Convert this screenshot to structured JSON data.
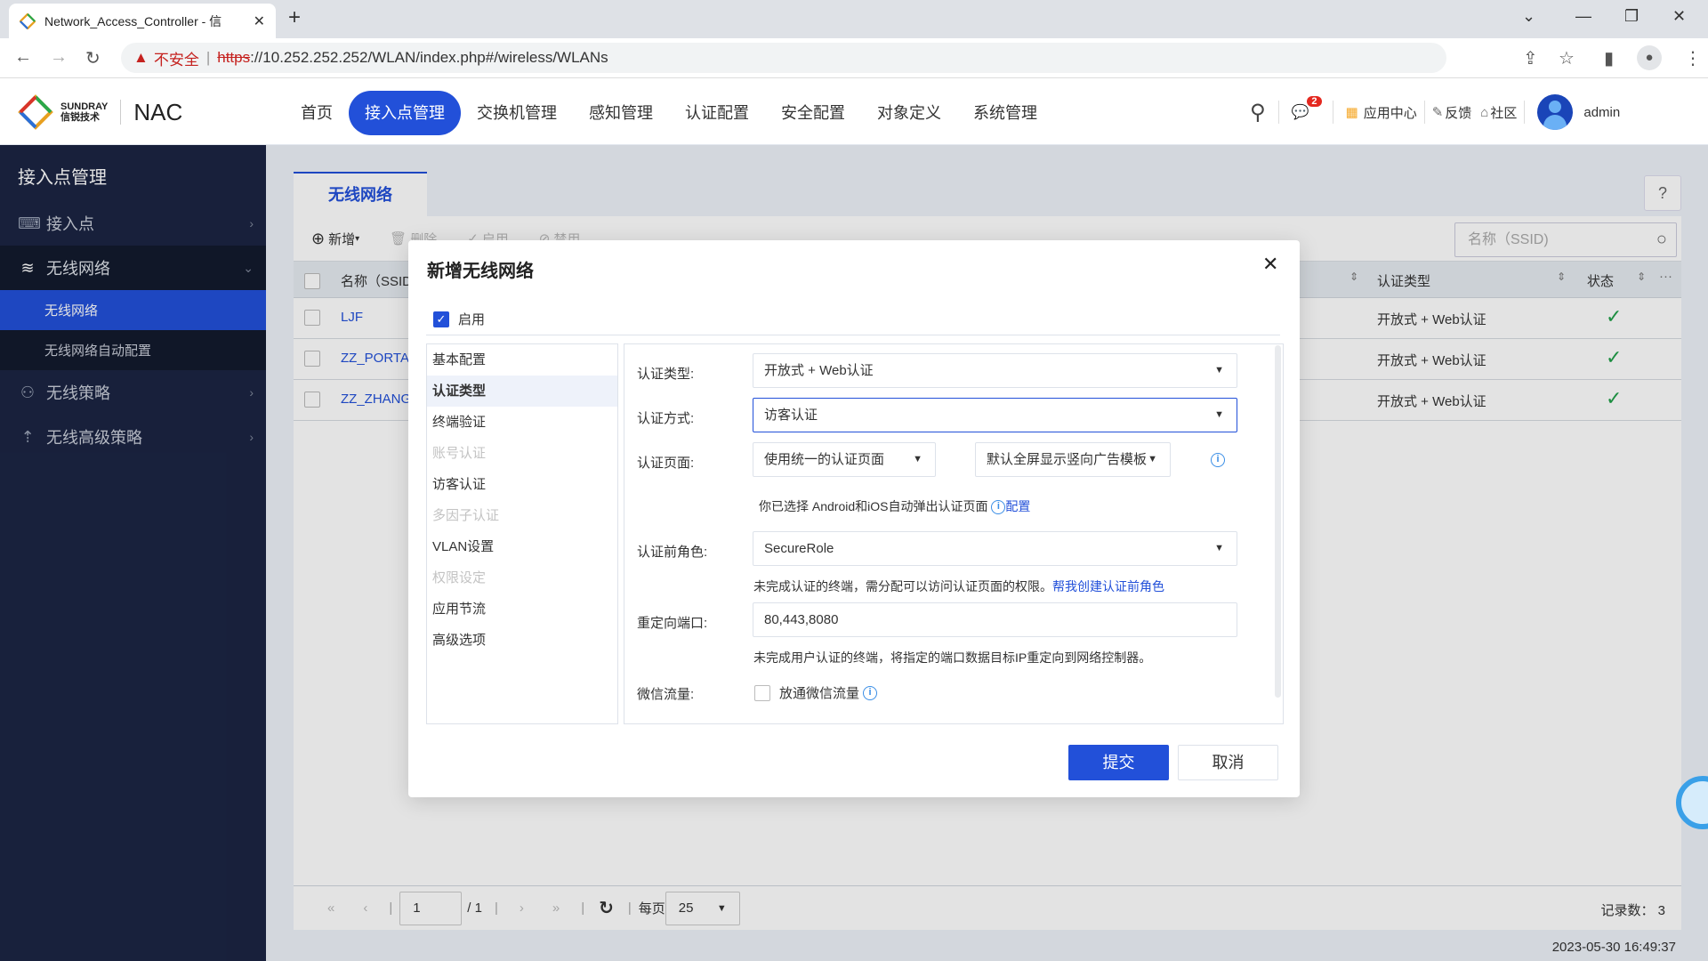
{
  "browser": {
    "tab_title": "Network_Access_Controller - 信",
    "new_tab": "+",
    "security_label": "不安全",
    "url_scheme": "https",
    "url_rest": "://10.252.252.252/WLAN/index.php#/wireless/WLANs"
  },
  "header": {
    "brand_top": "SUNDRAY",
    "brand_bottom": "信锐技术",
    "product": "NAC",
    "nav": [
      {
        "label": "首页",
        "active": false
      },
      {
        "label": "接入点管理",
        "active": true
      },
      {
        "label": "交换机管理",
        "active": false
      },
      {
        "label": "感知管理",
        "active": false
      },
      {
        "label": "认证配置",
        "active": false
      },
      {
        "label": "安全配置",
        "active": false
      },
      {
        "label": "对象定义",
        "active": false
      },
      {
        "label": "系统管理",
        "active": false
      }
    ],
    "message_count": "2",
    "app_center": "应用中心",
    "feedback": "反馈",
    "community": "社区",
    "user": "admin"
  },
  "sidebar": {
    "title": "接入点管理",
    "items": [
      {
        "label": "接入点",
        "icon": "router-icon"
      },
      {
        "label": "无线网络",
        "icon": "wifi-icon",
        "children": [
          "无线网络",
          "无线网络自动配置"
        ]
      },
      {
        "label": "无线策略",
        "icon": "policy-icon"
      },
      {
        "label": "无线高级策略",
        "icon": "advanced-policy-icon"
      }
    ]
  },
  "main": {
    "tab": "无线网络",
    "toolbar": {
      "add": "新增",
      "delete": "删除",
      "enable": "启用",
      "disable": "禁用"
    },
    "search_placeholder": "名称（SSID)",
    "columns": [
      "名称（SSID)",
      "认证类型",
      "状态"
    ],
    "rows": [
      {
        "name": "LJF",
        "auth": "开放式 + Web认证",
        "status": "✓"
      },
      {
        "name": "ZZ_PORTAL",
        "auth": "开放式 + Web认证",
        "status": "✓"
      },
      {
        "name": "ZZ_ZHANG",
        "auth": "开放式 + Web认证",
        "status": "✓"
      }
    ],
    "pager": {
      "page": "1",
      "total": "/ 1",
      "per_page_label": "每页",
      "per_page": "25",
      "records": "记录数： 3"
    }
  },
  "clock": "2023-05-30 16:49:37",
  "modal": {
    "title": "新增无线网络",
    "enable_label": "启用",
    "sections": [
      {
        "label": "基本配置",
        "state": "normal"
      },
      {
        "label": "认证类型",
        "state": "active"
      },
      {
        "label": "终端验证",
        "state": "normal"
      },
      {
        "label": "账号认证",
        "state": "disabled"
      },
      {
        "label": "访客认证",
        "state": "normal"
      },
      {
        "label": "多因子认证",
        "state": "disabled"
      },
      {
        "label": "VLAN设置",
        "state": "normal"
      },
      {
        "label": "权限设定",
        "state": "disabled"
      },
      {
        "label": "应用节流",
        "state": "normal"
      },
      {
        "label": "高级选项",
        "state": "normal"
      }
    ],
    "form": {
      "auth_type_label": "认证类型:",
      "auth_type_value": "开放式 + Web认证",
      "auth_method_label": "认证方式:",
      "auth_method_value": "访客认证",
      "auth_page_label": "认证页面:",
      "auth_page_value": "使用统一的认证页面",
      "auth_template_value": "默认全屏显示竖向广告模板",
      "popup_hint": "你已选择 Android和iOS自动弹出认证页面",
      "popup_config": "配置",
      "pre_role_label": "认证前角色:",
      "pre_role_value": "SecureRole",
      "pre_role_hint": "未完成认证的终端，需分配可以访问认证页面的权限。",
      "pre_role_link": "帮我创建认证前角色",
      "redirect_label": "重定向端口:",
      "redirect_value": "80,443,8080",
      "redirect_hint": "未完成用户认证的终端，将指定的端口数据目标IP重定向到网络控制器。",
      "wechat_label": "微信流量:",
      "wechat_option": "放通微信流量"
    },
    "submit": "提交",
    "cancel": "取消"
  }
}
